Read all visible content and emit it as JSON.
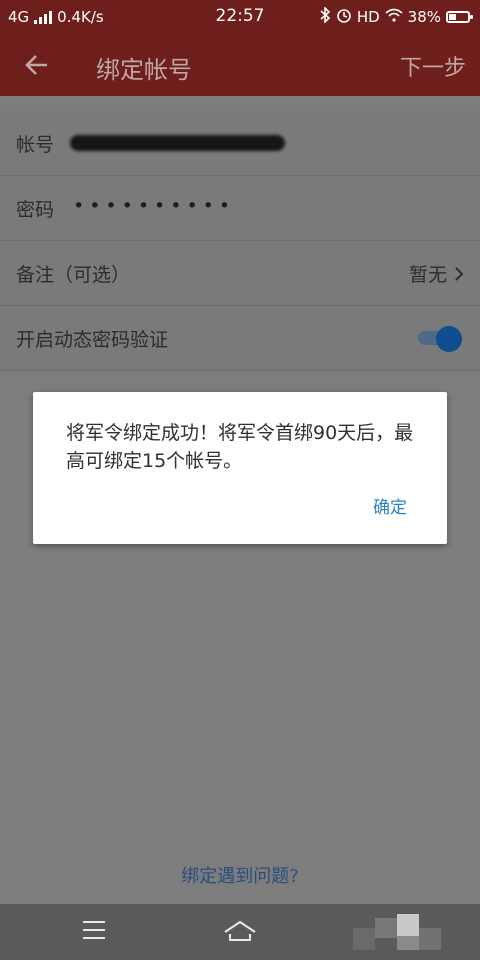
{
  "status_bar": {
    "network": "4G",
    "speed": "0.4K/s",
    "time": "22:57",
    "hd": "HD",
    "battery": "38%",
    "battery_level": 0.38
  },
  "app_bar": {
    "title": "绑定帐号",
    "next_label": "下一步",
    "back_icon": "arrow-left-icon"
  },
  "form": {
    "account_label": "帐号",
    "password_label": "密码",
    "password_value": "••••••••••",
    "note_label": "备注（可选）",
    "note_value": "暂无",
    "dynamic_label": "开启动态密码验证",
    "dynamic_enabled": true
  },
  "dialog": {
    "message": "将军令绑定成功！将军令首绑90天后，最高可绑定15个帐号。",
    "ok_label": "确定"
  },
  "help_link": "绑定遇到问题?",
  "nav": {
    "menu_icon": "menu-icon",
    "home_icon": "home-icon"
  }
}
